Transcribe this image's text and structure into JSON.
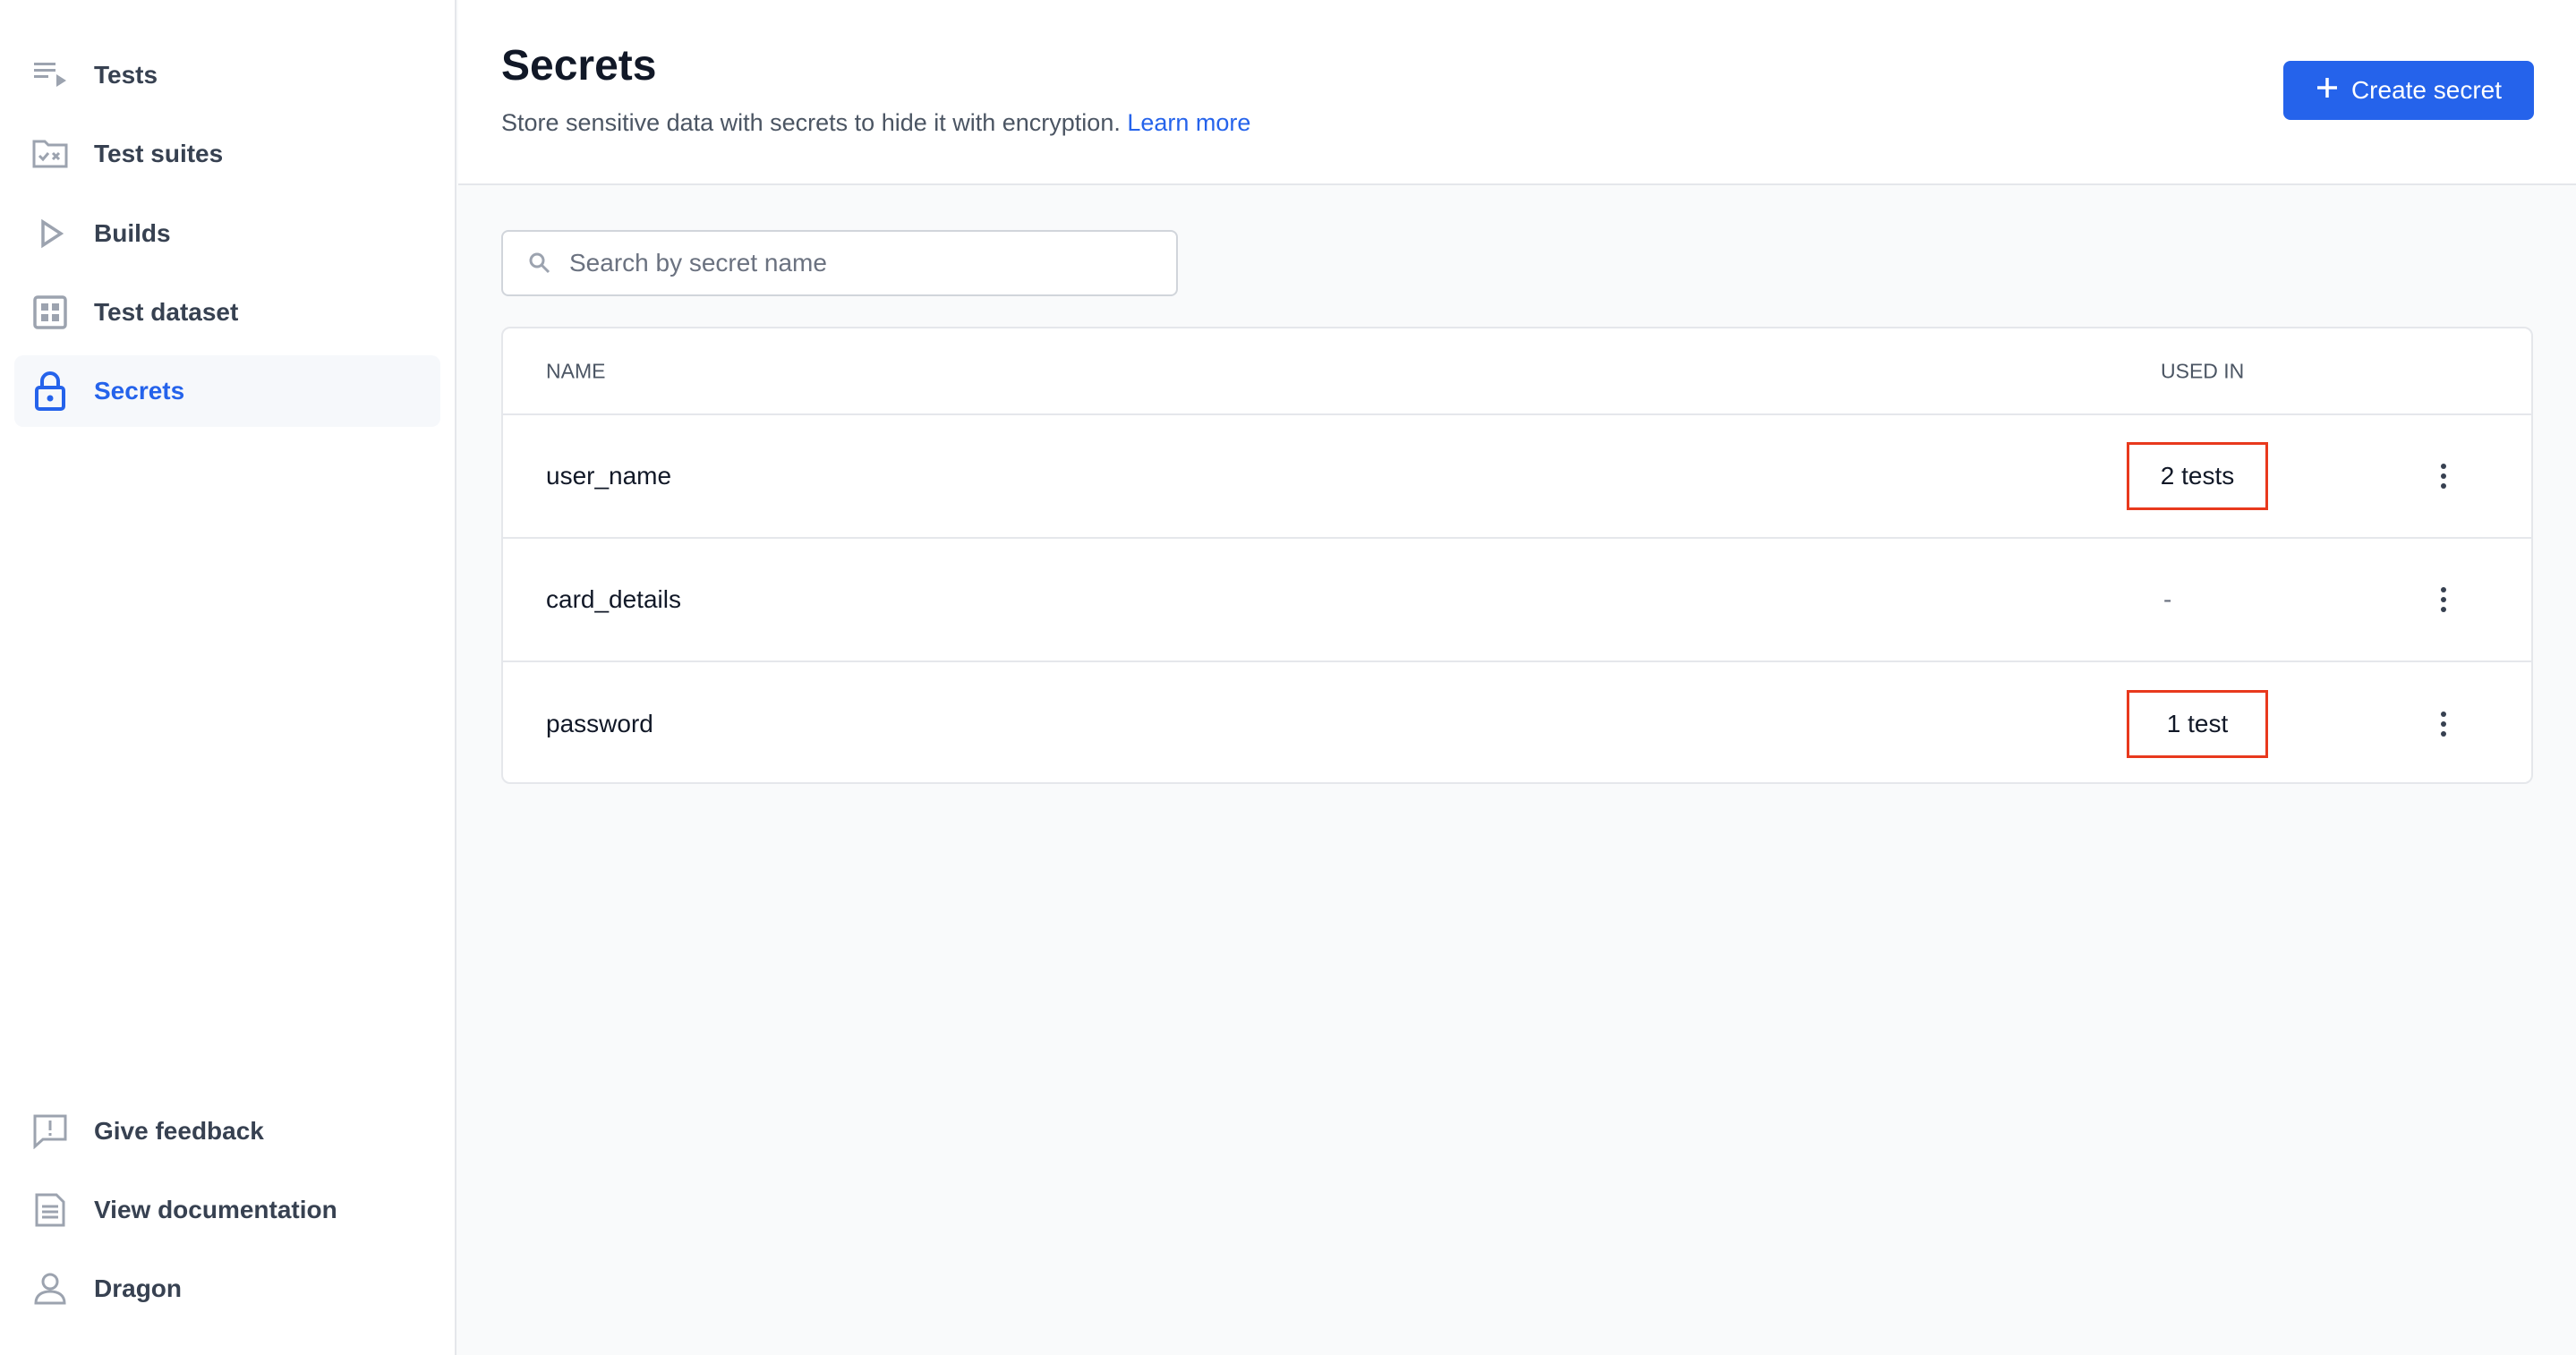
{
  "sidebar": {
    "items": [
      {
        "label": "Tests",
        "icon": "tests-icon"
      },
      {
        "label": "Test suites",
        "icon": "folder-check-icon"
      },
      {
        "label": "Builds",
        "icon": "play-icon"
      },
      {
        "label": "Test dataset",
        "icon": "grid-icon"
      },
      {
        "label": "Secrets",
        "icon": "lock-icon",
        "active": true
      }
    ],
    "bottom": [
      {
        "label": "Give feedback",
        "icon": "feedback-icon"
      },
      {
        "label": "View documentation",
        "icon": "document-icon"
      },
      {
        "label": "Dragon",
        "icon": "user-icon"
      }
    ]
  },
  "header": {
    "title": "Secrets",
    "subtitle": "Store sensitive data with secrets to hide it with encryption.",
    "learn_more": "Learn more",
    "create_button": "Create secret"
  },
  "search": {
    "placeholder": "Search by secret name",
    "value": ""
  },
  "table": {
    "columns": [
      "NAME",
      "USED IN"
    ],
    "rows": [
      {
        "name": "user_name",
        "used_in": "2 tests"
      },
      {
        "name": "card_details",
        "used_in": "-"
      },
      {
        "name": "password",
        "used_in": "1 test"
      }
    ]
  },
  "colors": {
    "accent": "#2563eb",
    "highlight": "#e8391d"
  }
}
